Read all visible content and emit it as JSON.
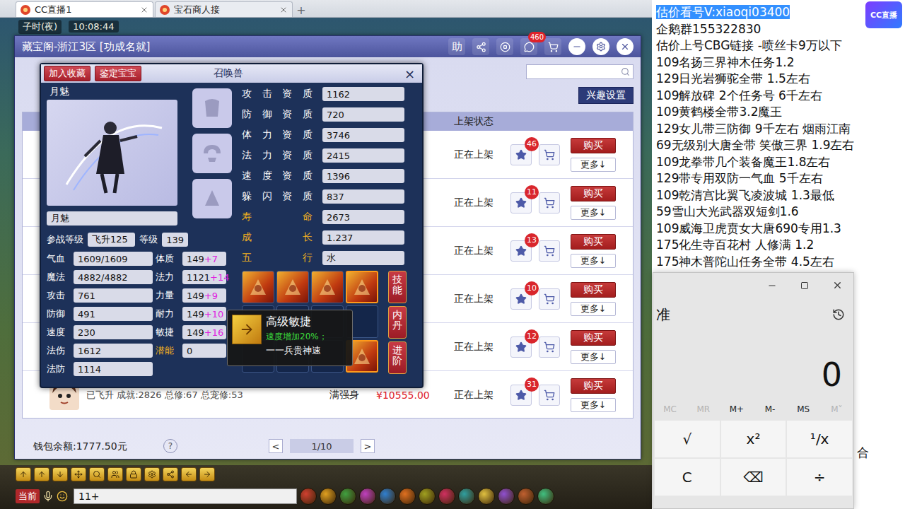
{
  "browser": {
    "tabs": [
      {
        "label": "CC直播1",
        "selected": true
      },
      {
        "label": "宝石商人接",
        "selected": false
      }
    ],
    "new_tab": "+"
  },
  "game_clock": {
    "period": "子时(夜)",
    "time": "10:08:44"
  },
  "cbg_window": {
    "title": "藏宝阁-浙江3区 [功成名就]",
    "help_button": "助",
    "chat_badge": "460",
    "interest_button": "兴趣设置",
    "status_column": "上架状态",
    "rows": [
      {
        "kind": "covered",
        "favorites": "46",
        "status": "正在上架",
        "buy": "购买",
        "more": "更多↓"
      },
      {
        "kind": "covered",
        "favorites": "11",
        "status": "正在上架",
        "buy": "购买",
        "more": "更多↓"
      },
      {
        "kind": "covered",
        "favorites": "13",
        "status": "正在上架",
        "buy": "购买",
        "more": "更多↓"
      },
      {
        "kind": "covered",
        "favorites": "10",
        "status": "正在上架",
        "buy": "购买",
        "more": "更多↓"
      },
      {
        "kind": "covered",
        "favorites": "12",
        "status": "正在上架",
        "buy": "购买",
        "more": "更多↓"
      },
      {
        "kind": "full",
        "summary": "已飞升 成就:2826 总修:67 总宠修:53",
        "tag": "满强身",
        "price": "¥10555.00",
        "favorites": "31",
        "status": "正在上架",
        "buy": "购买",
        "more": "更多↓"
      }
    ],
    "wallet": "钱包余额:1777.50元",
    "help": "?",
    "pager": {
      "prev": "<",
      "page": "1/10",
      "next": ">"
    }
  },
  "pet_window": {
    "title": "召唤兽",
    "collect_button": "加入收藏",
    "identify_button": "鉴定宝宝",
    "close": "×",
    "name": "月魅",
    "name_field": "月魅",
    "battle_level_label": "参战等级",
    "battle_level": "飞升125",
    "level_label": "等级",
    "level": "139",
    "stats": [
      {
        "label": "气血",
        "value": "1609/1609",
        "kind": "attribute",
        "attr_label": "体质",
        "attr": "149",
        "bonus": "+7"
      },
      {
        "label": "魔法",
        "value": "4882/4882",
        "kind": "attribute",
        "attr_label": "法力",
        "attr": "1121",
        "bonus": "+14"
      },
      {
        "label": "攻击",
        "value": "761",
        "kind": "attribute",
        "attr_label": "力量",
        "attr": "149",
        "bonus": "+9"
      },
      {
        "label": "防御",
        "value": "491",
        "kind": "attribute",
        "attr_label": "耐力",
        "attr": "149",
        "bonus": "+10"
      },
      {
        "label": "速度",
        "value": "230",
        "kind": "attribute",
        "attr_label": "敏捷",
        "attr": "149",
        "bonus": "+16"
      },
      {
        "label": "法伤",
        "value": "1612",
        "kind": "potential",
        "attr_label": "潜能",
        "attr": "0"
      },
      {
        "label": "法防",
        "value": "1114",
        "kind": "plain"
      }
    ],
    "aptitudes": [
      {
        "label": "攻击资质",
        "value": "1162",
        "highlight": false
      },
      {
        "label": "防御资质",
        "value": "720",
        "highlight": false
      },
      {
        "label": "体力资质",
        "value": "3746",
        "highlight": false
      },
      {
        "label": "法力资质",
        "value": "2415",
        "highlight": false
      },
      {
        "label": "速度资质",
        "value": "1396",
        "highlight": false
      },
      {
        "label": "躲闪资质",
        "value": "837",
        "highlight": false
      },
      {
        "label": "寿命",
        "value": "2673",
        "highlight": true
      },
      {
        "label": "成长",
        "value": "1.237",
        "highlight": true
      },
      {
        "label": "五行",
        "value": "水",
        "highlight": true
      }
    ],
    "skills": [
      {
        "kind": "skill",
        "selected": false
      },
      {
        "kind": "skill",
        "selected": false
      },
      {
        "kind": "skill",
        "selected": false
      },
      {
        "kind": "skill",
        "selected": true
      },
      {
        "kind": "empty",
        "selected": false
      },
      {
        "kind": "empty",
        "selected": false
      },
      {
        "kind": "empty",
        "selected": false
      },
      {
        "kind": "empty",
        "selected": false
      },
      {
        "kind": "empty",
        "selected": false
      },
      {
        "kind": "empty",
        "selected": false
      },
      {
        "kind": "empty",
        "selected": false
      },
      {
        "kind": "skill",
        "selected": true
      }
    ],
    "side_buttons": [
      "技能",
      "内丹",
      "进阶"
    ]
  },
  "tooltip": {
    "name": "高级敏捷",
    "effect": "速度增加20%；",
    "description": "一一兵贵神速"
  },
  "stream_panel": {
    "logo": "CC直播",
    "lines": [
      {
        "text": "估价看号V:xiaoqi03400",
        "selected": true
      },
      {
        "text": "企鹅群155322830",
        "selected": false
      },
      {
        "text": "估价上号CBG链接 -喷丝卡9万以下",
        "selected": false
      },
      {
        "text": "109名扬三界神木任务1.2",
        "selected": false
      },
      {
        "text": "129日光岩狮驼全带  1.5左右",
        "selected": false
      },
      {
        "text": "109解放碑 2个任务号 6千左右",
        "selected": false
      },
      {
        "text": "109黄鹤楼全带3.2魔王",
        "selected": false
      },
      {
        "text": "129女儿带三防御 9千左右 烟雨江南",
        "selected": false
      },
      {
        "text": "69无级别大唐全带  笑傲三界 1.9左右",
        "selected": false
      },
      {
        "text": "109龙拳带几个装备魔王1.8左右",
        "selected": false
      },
      {
        "text": "129带专用双防一气血 5千左右",
        "selected": false
      },
      {
        "text": "109乾清宫比翼飞凌波城 1.3最低",
        "selected": false
      },
      {
        "text": "59雪山大光武器双短剑1.6",
        "selected": false
      },
      {
        "text": "109威海卫虎贲女大唐690专用1.3",
        "selected": false
      },
      {
        "text": "175化生寺百花村 人修满 1.2",
        "selected": false
      },
      {
        "text": "175神木普陀山任务全带 4.5左右",
        "selected": false
      }
    ]
  },
  "calculator": {
    "mode": "准",
    "display": "0",
    "memory": [
      {
        "label": "MC",
        "disabled": true
      },
      {
        "label": "MR",
        "disabled": true
      },
      {
        "label": "M+",
        "disabled": false
      },
      {
        "label": "M-",
        "disabled": false
      },
      {
        "label": "MS",
        "disabled": false
      },
      {
        "label": "M˅",
        "disabled": true
      }
    ],
    "keys": [
      "√",
      "x²",
      "¹/x",
      "C",
      "⌫",
      "÷"
    ]
  },
  "background_text": "合",
  "game_toolbar": {
    "channel": "当前",
    "input": "11+"
  }
}
